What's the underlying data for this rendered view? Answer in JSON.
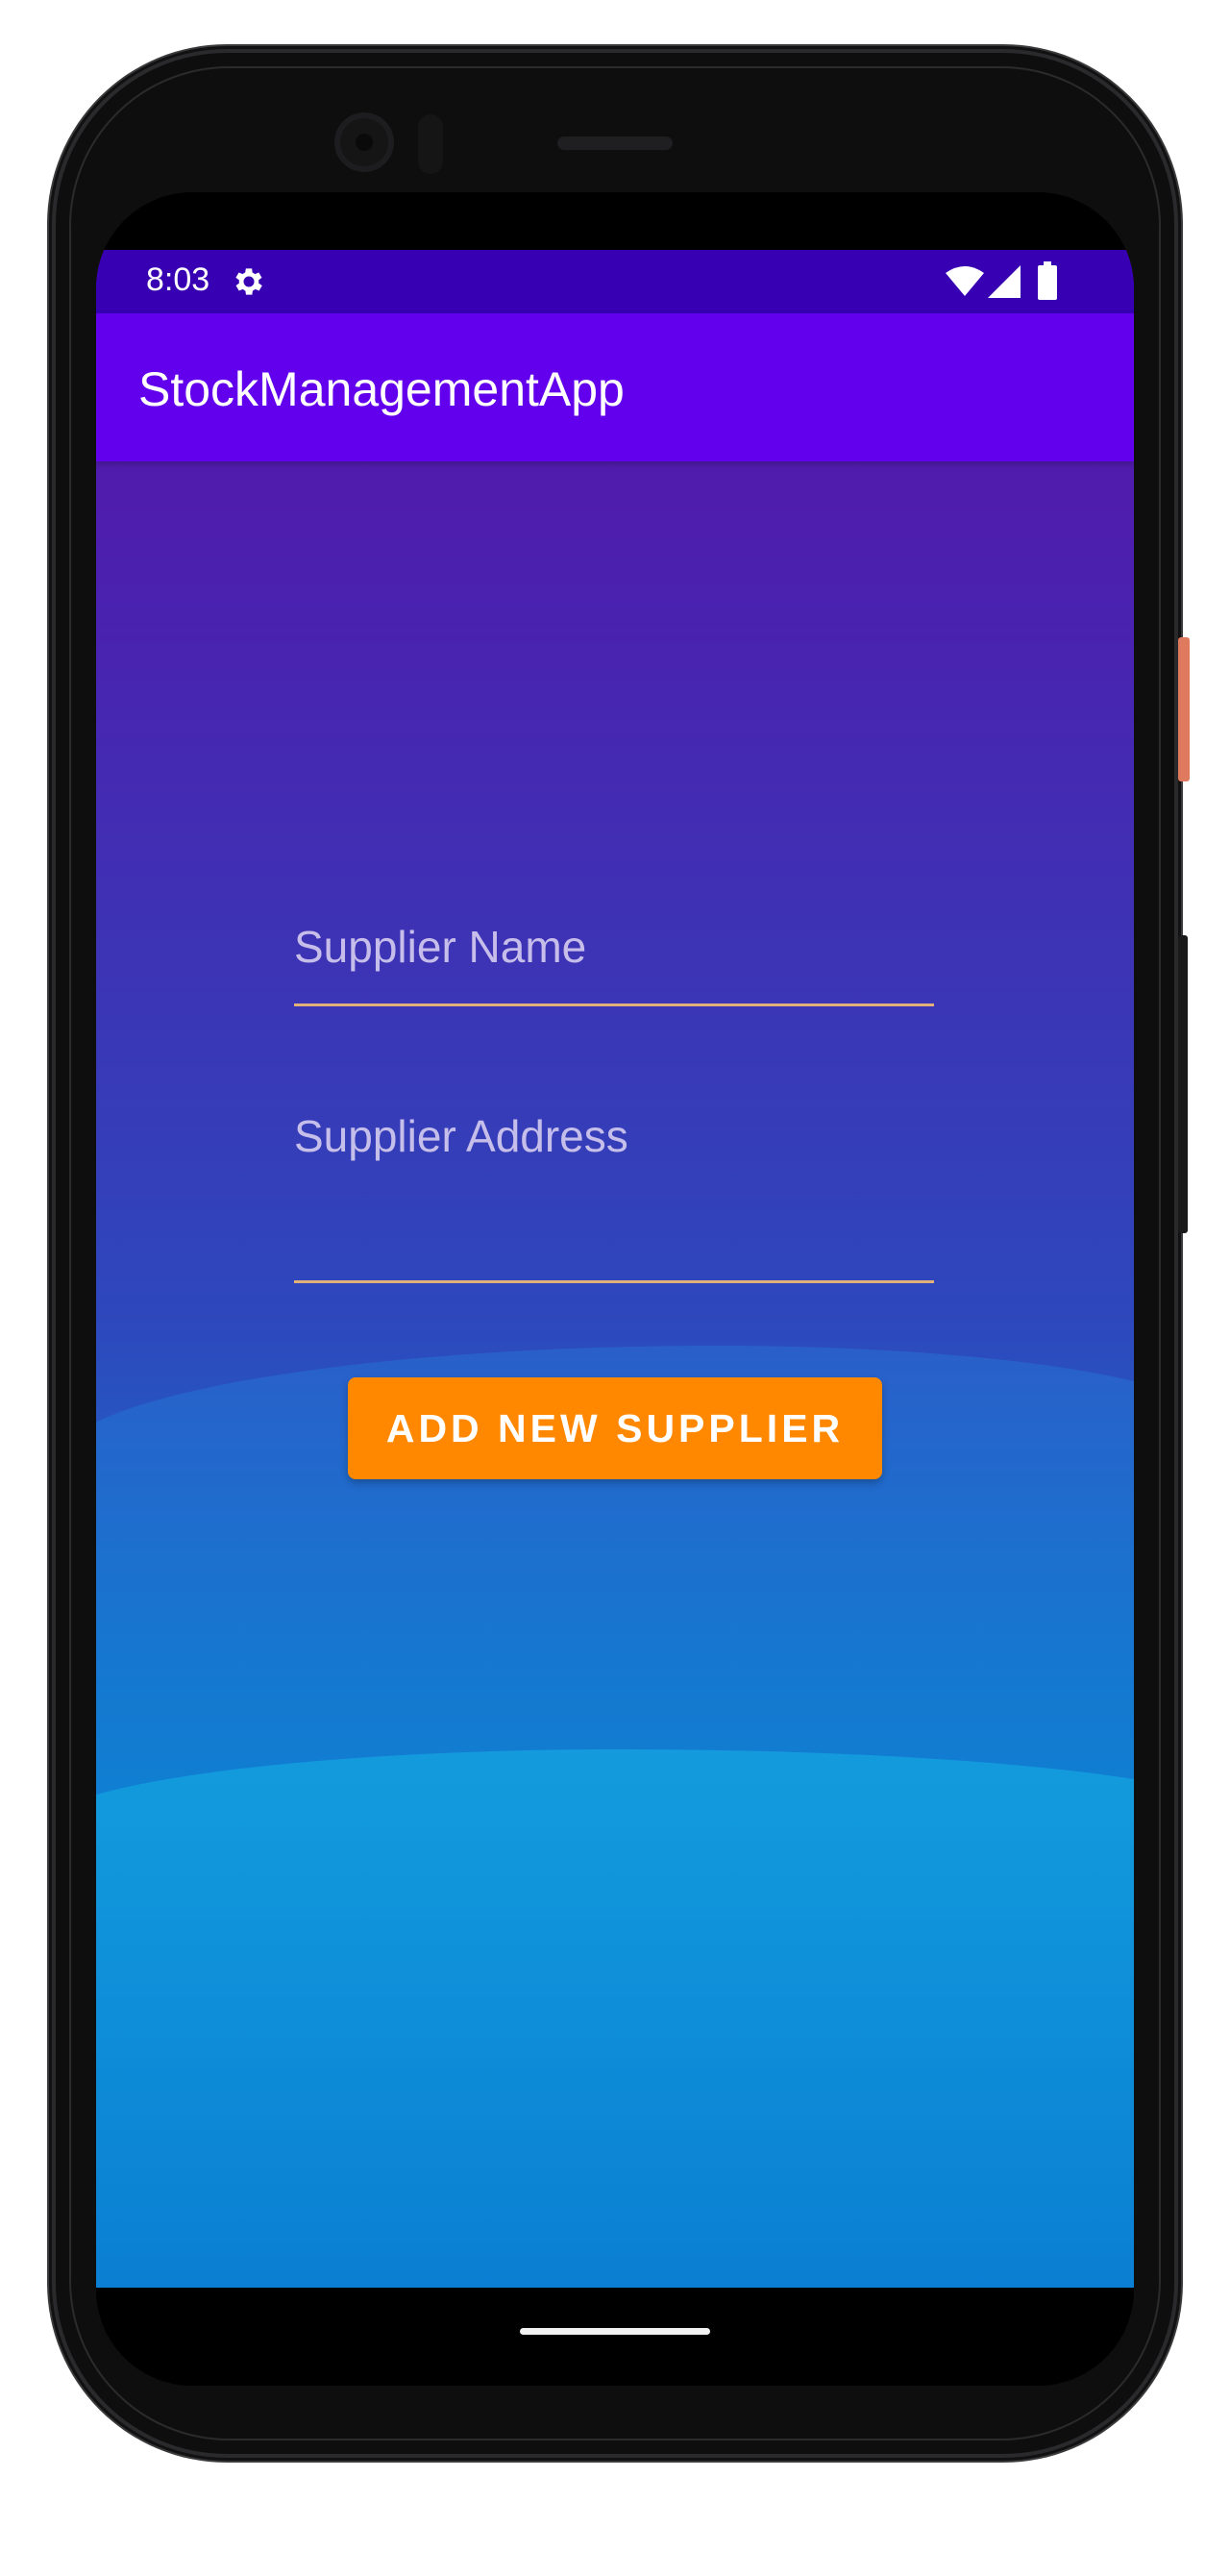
{
  "status_bar": {
    "time": "8:03",
    "icons": [
      "gear-icon",
      "wifi-icon",
      "signal-icon",
      "battery-icon"
    ]
  },
  "app_bar": {
    "title": "StockManagementApp"
  },
  "form": {
    "supplier_name_placeholder": "Supplier Name",
    "supplier_address_placeholder": "Supplier Address",
    "add_button_label": "ADD NEW SUPPLIER"
  },
  "colors": {
    "status_bar": "#3700b3",
    "app_bar": "#6200ee",
    "button": "#ff8800",
    "field_underline": "#e2b07a"
  }
}
